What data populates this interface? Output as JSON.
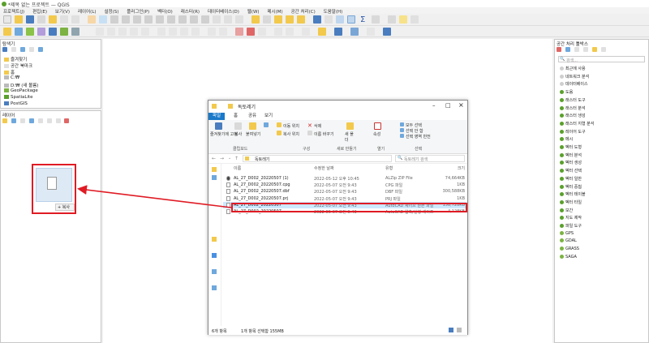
{
  "window": {
    "title": "*제목 없는 프로젝트 — QGIS"
  },
  "menubar": {
    "items": [
      "프로젝트(J)",
      "편집(E)",
      "보기(V)",
      "레이어(L)",
      "설정(S)",
      "플러그인(P)",
      "벡터(O)",
      "래스터(R)",
      "데이터베이스(D)",
      "웹(W)",
      "메시(M)",
      "공간 처리(C)",
      "도움말(H)"
    ]
  },
  "browser_panel": {
    "title": "탐색기",
    "items": [
      {
        "label": "즐겨찾기",
        "icon": "star-icon"
      },
      {
        "label": "공간 북마크",
        "icon": "bookmark-icon"
      },
      {
        "label": "홈",
        "icon": "folder-icon"
      },
      {
        "label": "C:₩",
        "icon": "drive-icon"
      },
      {
        "label": "D:₩ (새 볼륨)",
        "icon": "drive-icon"
      },
      {
        "label": "GeoPackage",
        "icon": "geopackage-icon"
      },
      {
        "label": "SpatiaLite",
        "icon": "spatialite-icon"
      },
      {
        "label": "PostGIS",
        "icon": "postgis-icon"
      }
    ]
  },
  "layers_panel": {
    "title": "레이어"
  },
  "drag_preview": {
    "badge": "+ 복사"
  },
  "toolbox_panel": {
    "title": "공간 처리 툴박스",
    "search_placeholder": "검색...",
    "items": [
      "최근에 사용",
      "네트워크 분석",
      "데이터베이스",
      "도움",
      "래스터 도구",
      "래스터 분석",
      "래스터 생성",
      "래스터 지형 분석",
      "레이어 도구",
      "메시",
      "벡터 도형",
      "벡터 분석",
      "벡터 생성",
      "벡터 선택",
      "벡터 일반",
      "벡터 중첩",
      "벡터 테이블",
      "벡터 타일",
      "보간",
      "지도 제작",
      "파일 도구",
      "GPS",
      "GDAL",
      "GRASS",
      "SAGA"
    ]
  },
  "explorer": {
    "title": "독토레기",
    "tabs": [
      "파일",
      "홈",
      "공유",
      "보기"
    ],
    "ribbon": {
      "pin_label": "즐겨찾기에 고정",
      "copy_label": "복사",
      "paste_label": "붙여넣기",
      "clipboard_group": "클립보드",
      "move_label": "이동 위치",
      "copy_to_label": "복사 위치",
      "delete_label": "삭제",
      "rename_label": "이름 바꾸기",
      "organize_group": "구성",
      "new_folder_label": "새 폴더",
      "new_group": "새로 만들기",
      "properties_label": "속성",
      "open_group": "열기",
      "select_all_label": "모두 선택",
      "select_none_label": "선택 안 함",
      "invert_label": "선택 영역 반전",
      "select_group": "선택"
    },
    "address": "독토레기",
    "search_placeholder": "독토레기 검색",
    "columns": [
      "이름",
      "수정한 날짜",
      "유형",
      "크기"
    ],
    "files": [
      {
        "name": "AL_27_D002_20220507 (1)",
        "date": "2022-05-12 오후 10:45",
        "type": "ALZip ZIP File",
        "size": "74,664KB"
      },
      {
        "name": "AL_27_D002_20220507.cpg",
        "date": "2022-05-07 오전 9:43",
        "type": "CPG 파일",
        "size": "1KB"
      },
      {
        "name": "AL_27_D002_20220507.dbf",
        "date": "2022-05-07 오전 9:43",
        "type": "DBF 파일",
        "size": "300,588KB"
      },
      {
        "name": "AL_27_D002_20220507.prj",
        "date": "2022-05-07 오전 9:43",
        "type": "PRJ 파일",
        "size": "1KB"
      },
      {
        "name": "AL_27_D002_20220507",
        "date": "2022-05-07 오전 9:43",
        "type": "AutoCAD 셰이프 원본 파일",
        "size": "158,728KB"
      },
      {
        "name": "AL_27_D002_20220507",
        "date": "2022-05-07 오전 9:43",
        "type": "AutoCAD 압축/실행 셰이프",
        "size": "4,128KB"
      }
    ],
    "status_count": "6개 항목",
    "status_selected": "1개 항목 선택함 155MB"
  },
  "colors": {
    "annotation_red": "#e01b24",
    "qgis_green": "#5aa02c",
    "selection_blue": "#cce8ff"
  }
}
